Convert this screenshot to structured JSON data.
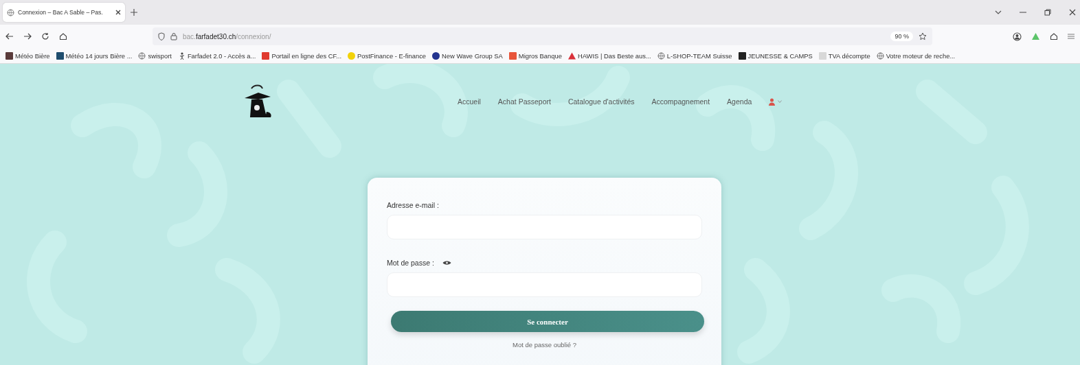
{
  "browser": {
    "tabs": [
      {
        "title": "Connexion – Bac A Sable – Pas.",
        "selected": true
      }
    ],
    "url": {
      "prefix": "bac.",
      "domain": "farfadet30.ch",
      "path": "/connexion/"
    },
    "zoom": "90 %",
    "bookmarks": [
      {
        "kind": "square",
        "color": "#5a3b3b",
        "label": "Météo Bière"
      },
      {
        "kind": "square",
        "color": "#1f4d6e",
        "label": "Météo 14 jours Bière ..."
      },
      {
        "kind": "globe",
        "label": "swisport"
      },
      {
        "kind": "figure",
        "label": "Farfadet 2.0 - Accès a..."
      },
      {
        "kind": "square",
        "color": "#e03a2f",
        "label": "Portail en ligne des CF..."
      },
      {
        "kind": "circle",
        "color": "#f2d20a",
        "label": "PostFinance - E-finance"
      },
      {
        "kind": "circle",
        "color": "#23338f",
        "label": "New Wave Group SA"
      },
      {
        "kind": "square",
        "color": "#e8553a",
        "label": "Migros Banque"
      },
      {
        "kind": "triangle",
        "color": "#d9303a",
        "label": "HAWIS | Das Beste aus..."
      },
      {
        "kind": "globe",
        "label": "L-SHOP-TEAM Suisse"
      },
      {
        "kind": "square",
        "color": "#222222",
        "label": "JEUNESSE & CAMPS"
      },
      {
        "kind": "square",
        "color": "#d8d8d8",
        "label": "TVA décompte"
      },
      {
        "kind": "globe",
        "label": "Votre moteur de reche..."
      }
    ]
  },
  "site": {
    "nav": [
      {
        "label": "Accueil"
      },
      {
        "label": "Achat Passeport"
      },
      {
        "label": "Catalogue d'activités"
      },
      {
        "label": "Accompagnement"
      },
      {
        "label": "Agenda"
      }
    ]
  },
  "login": {
    "email_label": "Adresse e-mail :",
    "password_label": "Mot de passe :",
    "submit": "Se connecter",
    "forgot": "Mot de passe oublié ?"
  }
}
